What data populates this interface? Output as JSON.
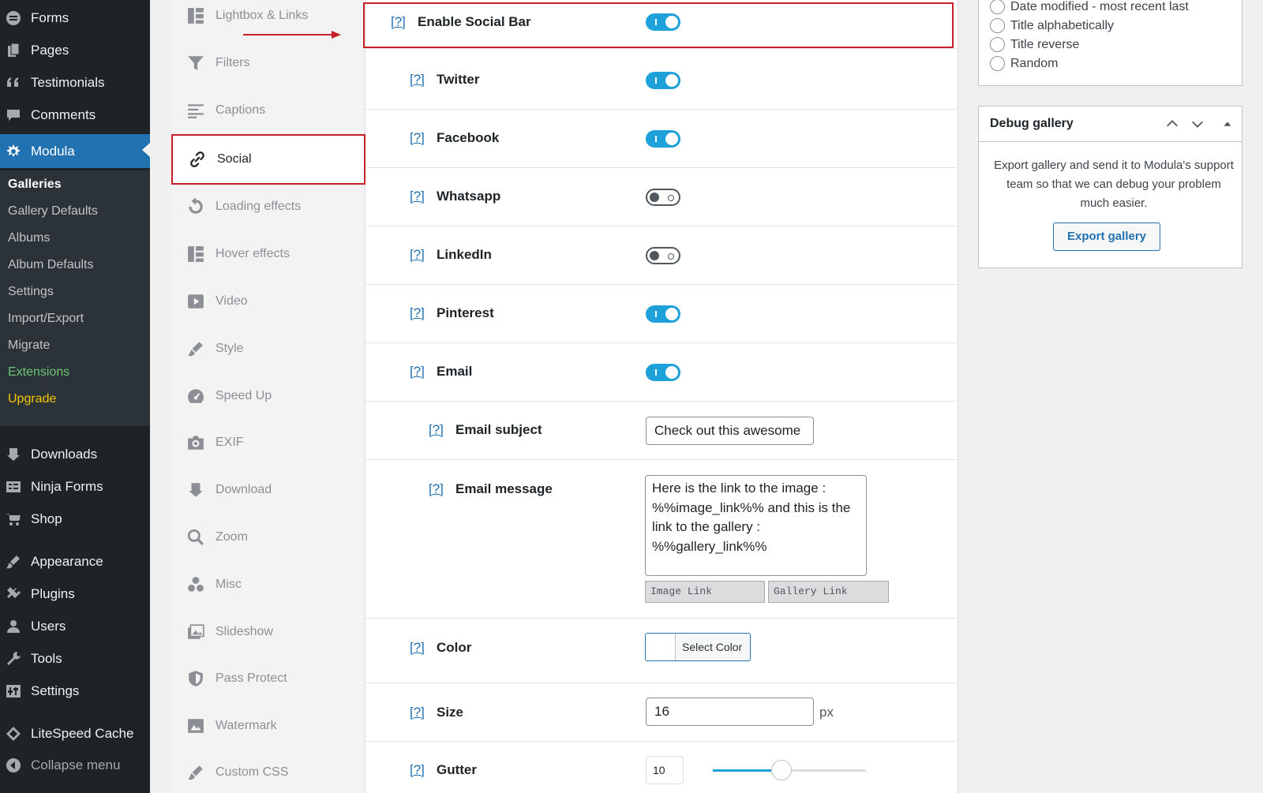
{
  "admin_menu": {
    "top_items": [
      {
        "label": "Forms",
        "icon": "forms-icon"
      },
      {
        "label": "Pages",
        "icon": "pages-icon"
      },
      {
        "label": "Testimonials",
        "icon": "quote-icon"
      },
      {
        "label": "Comments",
        "icon": "comments-icon"
      },
      {
        "label": "Modula",
        "icon": "modula-icon"
      }
    ],
    "submenu": [
      {
        "label": "Galleries"
      },
      {
        "label": "Gallery Defaults"
      },
      {
        "label": "Albums"
      },
      {
        "label": "Album Defaults"
      },
      {
        "label": "Settings"
      },
      {
        "label": "Import/Export"
      },
      {
        "label": "Migrate"
      },
      {
        "label": "Extensions"
      },
      {
        "label": "Upgrade"
      }
    ],
    "bottom_items": [
      {
        "label": "Downloads",
        "icon": "download-icon"
      },
      {
        "label": "Ninja Forms",
        "icon": "ninja-forms-icon"
      },
      {
        "label": "Shop",
        "icon": "cart-icon"
      },
      {
        "label": "Appearance",
        "icon": "brush-icon"
      },
      {
        "label": "Plugins",
        "icon": "plugin-icon"
      },
      {
        "label": "Users",
        "icon": "user-icon"
      },
      {
        "label": "Tools",
        "icon": "wrench-icon"
      },
      {
        "label": "Settings",
        "icon": "settings-icon"
      },
      {
        "label": "LiteSpeed Cache",
        "icon": "litespeed-icon"
      },
      {
        "label": "Collapse menu",
        "icon": "collapse-icon"
      }
    ]
  },
  "tabs": [
    {
      "label": "Lightbox & Links",
      "icon": "grid-icon"
    },
    {
      "label": "Filters",
      "icon": "filter-icon"
    },
    {
      "label": "Captions",
      "icon": "captions-icon"
    },
    {
      "label": "Social",
      "icon": "link-icon",
      "active": true
    },
    {
      "label": "Loading effects",
      "icon": "reload-icon"
    },
    {
      "label": "Hover effects",
      "icon": "grid-icon"
    },
    {
      "label": "Video",
      "icon": "video-icon"
    },
    {
      "label": "Style",
      "icon": "brush-icon"
    },
    {
      "label": "Speed Up",
      "icon": "dashboard-icon"
    },
    {
      "label": "EXIF",
      "icon": "camera-icon"
    },
    {
      "label": "Download",
      "icon": "download-icon"
    },
    {
      "label": "Zoom",
      "icon": "search-icon"
    },
    {
      "label": "Misc",
      "icon": "misc-icon"
    },
    {
      "label": "Slideshow",
      "icon": "slideshow-icon"
    },
    {
      "label": "Pass Protect",
      "icon": "shield-icon"
    },
    {
      "label": "Watermark",
      "icon": "watermark-icon"
    },
    {
      "label": "Custom CSS",
      "icon": "css-icon"
    }
  ],
  "settings": {
    "help_label": "[?]",
    "enable_social_bar": {
      "label": "Enable Social Bar",
      "on": true
    },
    "twitter": {
      "label": "Twitter",
      "on": true
    },
    "facebook": {
      "label": "Facebook",
      "on": true
    },
    "whatsapp": {
      "label": "Whatsapp",
      "on": false
    },
    "linkedin": {
      "label": "LinkedIn",
      "on": false
    },
    "pinterest": {
      "label": "Pinterest",
      "on": true
    },
    "email": {
      "label": "Email",
      "on": true
    },
    "email_subject": {
      "label": "Email subject",
      "value": "Check out this awesome"
    },
    "email_message": {
      "label": "Email message",
      "value": "Here is the link to the image : %%image_link%% and this is the link to the gallery : %%gallery_link%%",
      "image_link_btn": "Image Link",
      "gallery_link_btn": "Gallery Link"
    },
    "color": {
      "label": "Color",
      "button": "Select Color"
    },
    "size": {
      "label": "Size",
      "value": "16",
      "unit": "px"
    },
    "gutter": {
      "label": "Gutter",
      "value": "10",
      "slider_fraction": 0.45
    }
  },
  "sorting": {
    "options": [
      "Date modified - most recent last",
      "Title alphabetically",
      "Title reverse",
      "Random"
    ]
  },
  "debug_box": {
    "title": "Debug gallery",
    "text": "Export gallery and send it to Modula's support team so that we can debug your problem much easier.",
    "button": "Export gallery"
  },
  "colors": {
    "accent": "#2271b1",
    "toggle_on": "#1da1d8",
    "highlight": "#c8202a",
    "admin_bg": "#1d2327"
  }
}
